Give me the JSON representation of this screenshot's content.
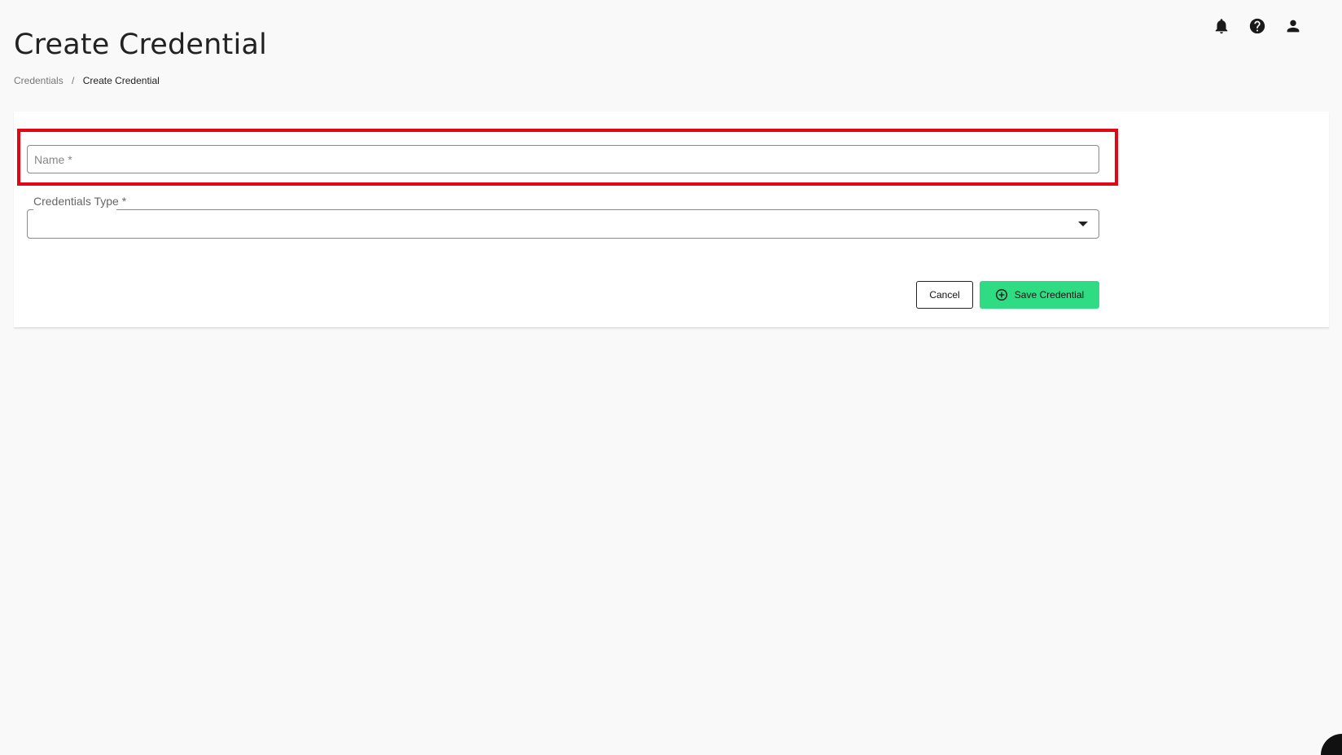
{
  "header": {
    "title": "Create Credential",
    "breadcrumb": {
      "parent": "Credentials",
      "separator": "/",
      "current": "Create Credential"
    }
  },
  "top_icons": [
    "bell-icon",
    "help-icon",
    "user-icon"
  ],
  "form": {
    "name": {
      "placeholder": "Name *",
      "value": ""
    },
    "credentials_type": {
      "label": "Credentials Type *",
      "value": ""
    },
    "cancel_label": "Cancel",
    "save_label": "Save Credential"
  },
  "colors": {
    "save_button": "#2fdc83",
    "highlight": "#e30613",
    "background": "#f9f9f9"
  }
}
